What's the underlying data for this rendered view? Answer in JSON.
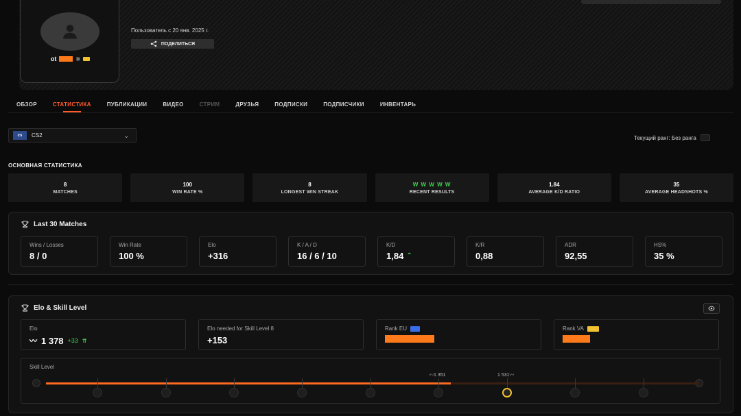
{
  "profile": {
    "nickname_visible": "ot",
    "member_since": "Пользователь с 20 янв. 2025 г.",
    "share_label": "ПОДЕЛИТЬСЯ"
  },
  "tabs": [
    {
      "label": "ОБЗОР",
      "state": "normal"
    },
    {
      "label": "СТАТИСТИКА",
      "state": "active"
    },
    {
      "label": "ПУБЛИКАЦИИ",
      "state": "normal"
    },
    {
      "label": "ВИДЕО",
      "state": "normal"
    },
    {
      "label": "СТРИМ",
      "state": "muted"
    },
    {
      "label": "ДРУЗЬЯ",
      "state": "normal"
    },
    {
      "label": "ПОДПИСКИ",
      "state": "normal"
    },
    {
      "label": "ПОДПИСЧИКИ",
      "state": "normal"
    },
    {
      "label": "ИНВЕНТАРЬ",
      "state": "normal"
    }
  ],
  "game_select": {
    "logo": "cs",
    "value": "CS2"
  },
  "rank": {
    "label": "Текущий ранг: Без ранга"
  },
  "main_stats": {
    "title": "ОСНОВНАЯ СТАТИСТИКА",
    "items": [
      {
        "value": "8",
        "label": "MATCHES"
      },
      {
        "value": "100",
        "label": "WIN RATE %"
      },
      {
        "value": "8",
        "label": "LONGEST WIN STREAK"
      },
      {
        "value": "W W W W W",
        "label": "RECENT RESULTS"
      },
      {
        "value": "1.84",
        "label": "AVERAGE K/D RATIO"
      },
      {
        "value": "35",
        "label": "AVERAGE HEADSHOTS %"
      }
    ]
  },
  "last30": {
    "title": "Last 30 Matches",
    "items": [
      {
        "label": "Wins / Losses",
        "value": "8 / 0"
      },
      {
        "label": "Win Rate",
        "value": "100 %"
      },
      {
        "label": "Elo",
        "value": "+316"
      },
      {
        "label": "K / A / D",
        "value": "16 / 6 / 10"
      },
      {
        "label": "K/D",
        "value": "1,84"
      },
      {
        "label": "K/R",
        "value": "0,88"
      },
      {
        "label": "ADR",
        "value": "92,55"
      },
      {
        "label": "HS%",
        "value": "35 %"
      }
    ]
  },
  "elo_panel": {
    "title": "Elo & Skill Level",
    "elo_label": "Elo",
    "elo_value": "1 378",
    "elo_delta": "+33",
    "needed_label": "Elo needed for Skill Level 8",
    "needed_value": "+153",
    "rank_eu_label": "Rank EU",
    "rank_va_label": "Rank VA",
    "skill_label": "Skill Level",
    "skill_mark_left": "1 351",
    "skill_mark_right": "1 531",
    "skill_progress": 0.62,
    "skill_current_level": 7
  },
  "colors": {
    "accent": "#ff5a2c",
    "progress": "#ff6a1f",
    "win": "#3ed34d",
    "redacted": "#ff7a1a"
  }
}
